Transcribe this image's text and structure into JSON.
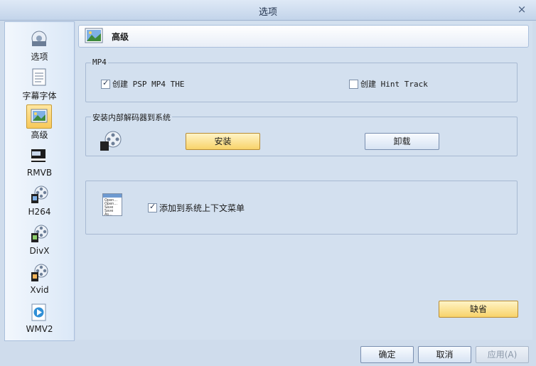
{
  "window": {
    "title": "选项",
    "close": "×"
  },
  "sidebar": {
    "items": [
      {
        "label": "选项",
        "icon": "options-icon"
      },
      {
        "label": "字幕字体",
        "icon": "document-icon"
      },
      {
        "label": "高级",
        "icon": "picture-icon",
        "selected": true
      },
      {
        "label": "RMVB",
        "icon": "real-video-icon"
      },
      {
        "label": "H264",
        "icon": "film-reel-icon"
      },
      {
        "label": "DivX",
        "icon": "film-reel-icon"
      },
      {
        "label": "Xvid",
        "icon": "film-reel-icon"
      },
      {
        "label": "WMV2",
        "icon": "media-player-icon"
      }
    ]
  },
  "header": {
    "title": "高级"
  },
  "mp4": {
    "label": "MP4",
    "psp_label": "创建 PSP MP4 THE",
    "psp_checked": true,
    "hint_label": "创建 Hint Track",
    "hint_checked": false
  },
  "codec": {
    "label": "安装内部解码器到系统",
    "install": "安装",
    "uninstall": "卸载"
  },
  "context": {
    "label": "添加到系统上下文菜单",
    "checked": true,
    "menu_lines": [
      "Open...",
      "Open...",
      "Save",
      "Save As..."
    ]
  },
  "buttons": {
    "default": "缺省",
    "ok": "确定",
    "cancel": "取消",
    "apply": "应用(A)"
  },
  "colors": {
    "accent_yellow": "#f8d36a",
    "selection": "#f7c95a"
  }
}
